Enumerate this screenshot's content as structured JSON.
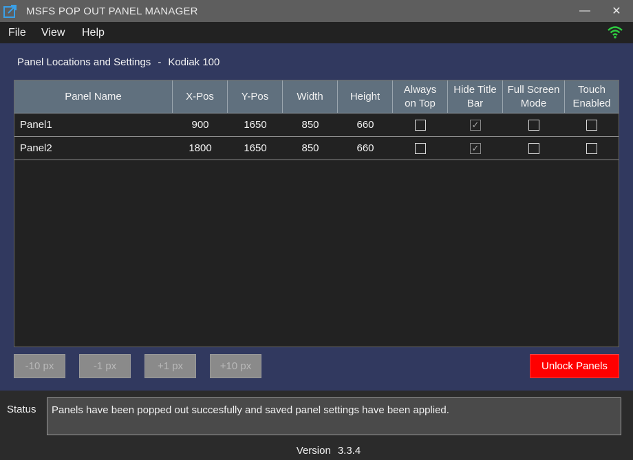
{
  "window": {
    "title": "MSFS POP OUT PANEL MANAGER",
    "minimize_icon": "minimize-icon",
    "close_icon": "close-icon",
    "minimize_glyph": "—",
    "close_glyph": "✕"
  },
  "menu": {
    "items": [
      "File",
      "View",
      "Help"
    ],
    "connection_icon": "wifi-icon",
    "connection_color": "#2ecc40"
  },
  "main": {
    "heading": "Panel Locations and Settings",
    "separator": "-",
    "aircraft": "Kodiak 100",
    "columns": {
      "panel_name": "Panel Name",
      "x_pos": "X-Pos",
      "y_pos": "Y-Pos",
      "width": "Width",
      "height": "Height",
      "always_on_top": [
        "Always",
        "on Top"
      ],
      "hide_title_bar": [
        "Hide Title",
        "Bar"
      ],
      "full_screen": [
        "Full Screen",
        "Mode"
      ],
      "touch_enabled": [
        "Touch",
        "Enabled"
      ]
    },
    "rows": [
      {
        "name": "Panel1",
        "x": "900",
        "y": "1650",
        "width": "850",
        "height": "660",
        "always_on_top": false,
        "hide_title_bar": true,
        "full_screen": false,
        "touch_enabled": false
      },
      {
        "name": "Panel2",
        "x": "1800",
        "y": "1650",
        "width": "850",
        "height": "660",
        "always_on_top": false,
        "hide_title_bar": true,
        "full_screen": false,
        "touch_enabled": false
      }
    ],
    "buttons": {
      "minus10": "-10 px",
      "minus1": "-1 px",
      "plus1": "+1 px",
      "plus10": "+10 px",
      "unlock": "Unlock Panels"
    },
    "accent_color": "#ff0000"
  },
  "status": {
    "label": "Status",
    "message": "Panels have been popped out succesfully and saved panel settings have been applied."
  },
  "footer": {
    "version_label": "Version",
    "version_number": "3.3.4"
  }
}
